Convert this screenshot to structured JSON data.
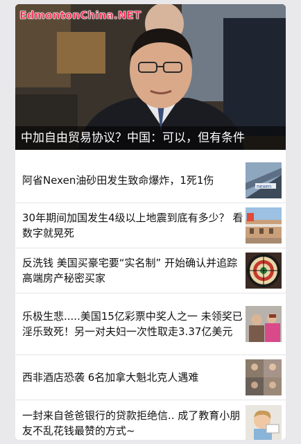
{
  "watermark": "EdmontonChina.NET",
  "hero": {
    "caption": "中加自由贸易协议？中国：可以，但有条件",
    "image_desc": "hero-photo"
  },
  "news": [
    {
      "title": "阿省Nexen油砂田发生致命爆炸，1死1伤",
      "thumb": "nexen-building-thumb"
    },
    {
      "title": "30年期间加国发生4级以上地震到底有多少？ 看数字就晃死",
      "thumb": "building-thumb"
    },
    {
      "title": "反洗钱 美国买豪宅要“实名制” 开始确认并追踪高端房产秘密买家",
      "thumb": "dartboard-thumb"
    },
    {
      "title": "乐极生悲.....美国15亿彩票中奖人之一 未领奖已淫乐致死！另一对夫妇一次性取走3.37亿美元",
      "thumb": "lottery-winners-thumb"
    },
    {
      "title": "西非酒店恐袭 6名加拿大魁北克人遇难",
      "thumb": "victims-thumb"
    },
    {
      "title": "一封来自爸爸银行的贷款拒绝信.. 成了教育小朋友不乱花钱最赞的方式~",
      "thumb": "child-thumb"
    }
  ]
}
